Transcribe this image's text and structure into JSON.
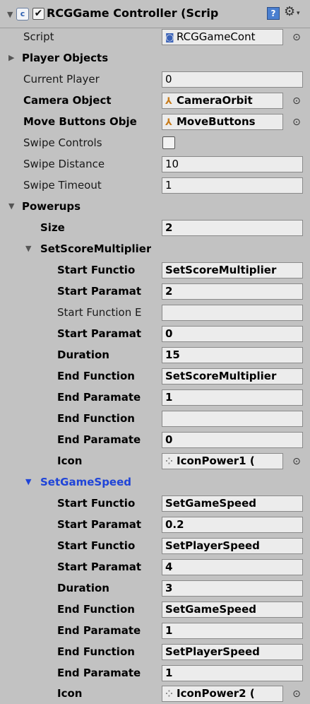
{
  "component": {
    "title": "RCGGame Controller (Scrip",
    "enabled_check": "✔",
    "script_icon": "script-icon",
    "help_icon": "?",
    "gear_icon": "⚙",
    "gear_dropdown": "▾"
  },
  "fields": {
    "script": {
      "label": "Script",
      "value": "RCGGameCont"
    },
    "player_objects": {
      "label": "Player Objects"
    },
    "current_player": {
      "label": "Current Player",
      "value": "0"
    },
    "camera_object": {
      "label": "Camera Object",
      "value": "CameraOrbit"
    },
    "move_buttons": {
      "label": "Move Buttons Obje",
      "value": "MoveButtons"
    },
    "swipe_controls": {
      "label": "Swipe Controls",
      "checked": false
    },
    "swipe_distance": {
      "label": "Swipe Distance",
      "value": "10"
    },
    "swipe_timeout": {
      "label": "Swipe Timeout",
      "value": "1"
    }
  },
  "powerups": {
    "label": "Powerups",
    "size": {
      "label": "Size",
      "value": "2"
    },
    "items": [
      {
        "name": "SetScoreMultiplier",
        "fields": [
          {
            "label": "Start Functio",
            "value": "SetScoreMultiplier",
            "bold": true
          },
          {
            "label": "Start Paramat",
            "value": "2",
            "bold": true
          },
          {
            "label": "Start Function E",
            "value": "",
            "bold": false
          },
          {
            "label": "Start Paramat",
            "value": "0",
            "bold": true
          },
          {
            "label": "Duration",
            "value": "15",
            "bold": true
          },
          {
            "label": "End Function",
            "value": "SetScoreMultiplier",
            "bold": true
          },
          {
            "label": "End Paramate",
            "value": "1",
            "bold": true
          },
          {
            "label": "End Function",
            "value": "",
            "bold": true
          },
          {
            "label": "End Paramate",
            "value": "0",
            "bold": true
          }
        ],
        "icon": {
          "label": "Icon",
          "value": "IconPower1 ("
        }
      },
      {
        "name": "SetGameSpeed",
        "fields": [
          {
            "label": "Start Functio",
            "value": "SetGameSpeed",
            "bold": true
          },
          {
            "label": "Start Paramat",
            "value": "0.2",
            "bold": true
          },
          {
            "label": "Start Functio",
            "value": "SetPlayerSpeed",
            "bold": true
          },
          {
            "label": "Start Paramat",
            "value": "4",
            "bold": true
          },
          {
            "label": "Duration",
            "value": "3",
            "bold": true
          },
          {
            "label": "End Function",
            "value": "SetGameSpeed",
            "bold": true
          },
          {
            "label": "End Paramate",
            "value": "1",
            "bold": true
          },
          {
            "label": "End Function",
            "value": "SetPlayerSpeed",
            "bold": true
          },
          {
            "label": "End Paramate",
            "value": "1",
            "bold": true
          }
        ],
        "icon": {
          "label": "Icon",
          "value": "IconPower2 ("
        }
      }
    ]
  },
  "glyphs": {
    "expanded": "▼",
    "collapsed": "▶",
    "picker": "⊙",
    "script_ref": "◙",
    "gameobject": "⅄",
    "texture": "⁘"
  },
  "colors": {
    "background": "#c2c2c2",
    "field": "#ececec",
    "selected_foldout": "#1f44d8"
  }
}
